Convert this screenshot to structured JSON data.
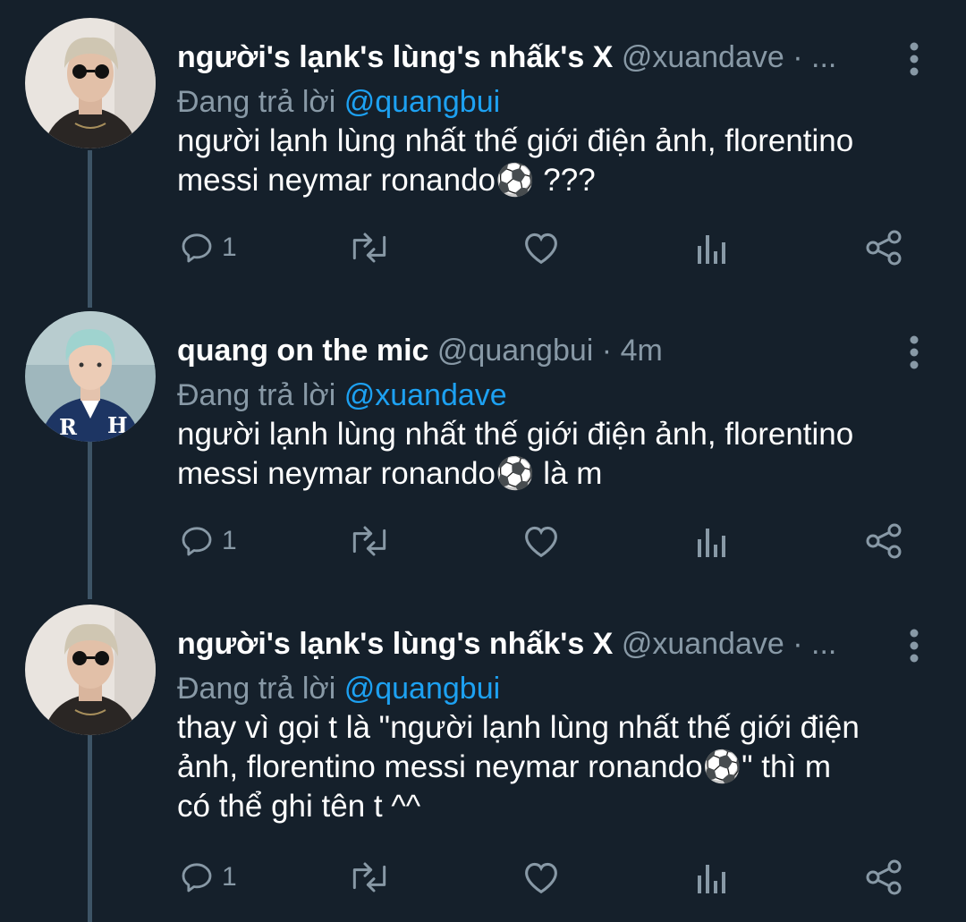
{
  "tweets": [
    {
      "display_name": "người's lạnk's lùng's nhấk's X",
      "handle": "@xuandave",
      "separator": "·",
      "time": "...",
      "reply_prefix": "Đang trả lời",
      "reply_to": "@quangbui",
      "text": "người lạnh lùng nhất thế giới điện ảnh, florentino\nmessi neymar ronando⚽ ???",
      "reply_count": "1",
      "avatar": "avatar-blond-sunglasses"
    },
    {
      "display_name": "quang on the mic",
      "handle": "@quangbui",
      "separator": "·",
      "time": "4m",
      "reply_prefix": "Đang trả lời",
      "reply_to": "@xuandave",
      "text": "người lạnh lùng nhất thế giới điện ảnh, florentino\nmessi neymar ronando⚽ là m",
      "reply_count": "1",
      "avatar": "avatar-blue-jacket"
    },
    {
      "display_name": "người's lạnk's lùng's nhấk's X",
      "handle": "@xuandave",
      "separator": "·",
      "time": "...",
      "reply_prefix": "Đang trả lời",
      "reply_to": "@quangbui",
      "text": "thay vì gọi t là \"người lạnh lùng nhất thế giới điện\nảnh, florentino messi neymar ronando⚽\" thì m\ncó thể ghi tên t ^^",
      "reply_count": "1",
      "avatar": "avatar-blond-sunglasses"
    }
  ],
  "icons": [
    "reply-icon",
    "retweet-icon",
    "like-icon",
    "analytics-icon",
    "share-icon",
    "more-options-icon"
  ],
  "colors": {
    "background": "#15202b",
    "text_primary": "#ffffff",
    "text_secondary": "#8899a6",
    "accent": "#1da1f2",
    "thread_line": "#3d5466"
  }
}
